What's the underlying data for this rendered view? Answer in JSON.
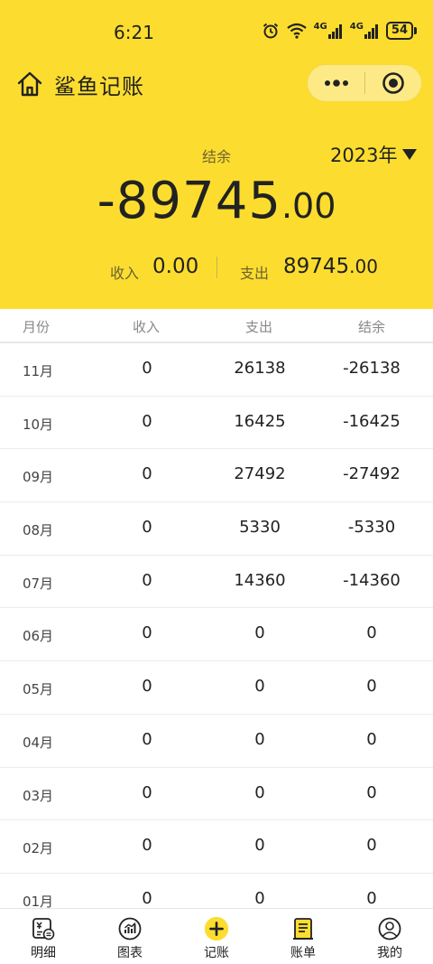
{
  "status_bar": {
    "time": "6:21",
    "network_left": "4G",
    "network_right": "4G",
    "battery": "54"
  },
  "nav": {
    "title": "鲨鱼记账"
  },
  "summary": {
    "balance_label": "结余",
    "year": "2023年",
    "balance_integer": "-89745",
    "balance_decimal": ".00",
    "income_label": "收入",
    "income_value": "0.00",
    "expense_label": "支出",
    "expense_integer": "89745",
    "expense_decimal": ".00"
  },
  "table": {
    "headers": [
      "月份",
      "收入",
      "支出",
      "结余"
    ],
    "rows": [
      {
        "month": "11月",
        "income": "0",
        "expense": "26138",
        "balance": "-26138"
      },
      {
        "month": "10月",
        "income": "0",
        "expense": "16425",
        "balance": "-16425"
      },
      {
        "month": "09月",
        "income": "0",
        "expense": "27492",
        "balance": "-27492"
      },
      {
        "month": "08月",
        "income": "0",
        "expense": "5330",
        "balance": "-5330"
      },
      {
        "month": "07月",
        "income": "0",
        "expense": "14360",
        "balance": "-14360"
      },
      {
        "month": "06月",
        "income": "0",
        "expense": "0",
        "balance": "0"
      },
      {
        "month": "05月",
        "income": "0",
        "expense": "0",
        "balance": "0"
      },
      {
        "month": "04月",
        "income": "0",
        "expense": "0",
        "balance": "0"
      },
      {
        "month": "03月",
        "income": "0",
        "expense": "0",
        "balance": "0"
      },
      {
        "month": "02月",
        "income": "0",
        "expense": "0",
        "balance": "0"
      },
      {
        "month": "01月",
        "income": "0",
        "expense": "0",
        "balance": "0"
      }
    ]
  },
  "tab_bar": {
    "items": [
      {
        "label": "明细",
        "icon": "ledger-detail-icon"
      },
      {
        "label": "图表",
        "icon": "chart-icon"
      },
      {
        "label": "记账",
        "icon": "add-record-icon"
      },
      {
        "label": "账单",
        "icon": "bill-icon"
      },
      {
        "label": "我的",
        "icon": "profile-icon"
      }
    ]
  },
  "colors": {
    "brand_yellow": "#fcdd2f",
    "text": "#222222",
    "muted": "#888888"
  }
}
